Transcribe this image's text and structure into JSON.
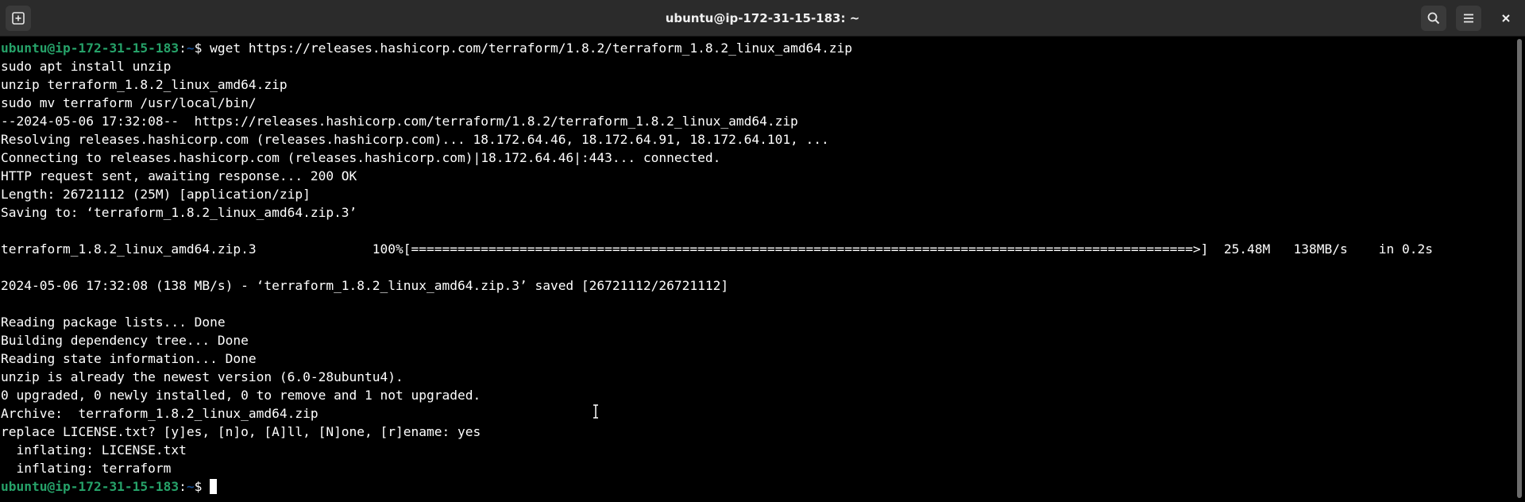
{
  "window": {
    "title": "ubuntu@ip-172-31-15-183: ~"
  },
  "icons": {
    "new_tab": "new-tab-icon",
    "search": "search-icon",
    "menu": "hamburger-menu-icon",
    "close": "close-icon"
  },
  "colors": {
    "prompt_user": "#26a269",
    "prompt_path": "#12488b",
    "background": "#000000",
    "foreground": "#ffffff",
    "headerbar": "#2b2b2b"
  },
  "terminal": {
    "prompt_user": "ubuntu@ip-172-31-15-183",
    "prompt_path": "~",
    "first_command": "wget https://releases.hashicorp.com/terraform/1.8.2/terraform_1.8.2_linux_amd64.zip",
    "lines": [
      "sudo apt install unzip",
      "unzip terraform_1.8.2_linux_amd64.zip",
      "sudo mv terraform /usr/local/bin/",
      "--2024-05-06 17:32:08--  https://releases.hashicorp.com/terraform/1.8.2/terraform_1.8.2_linux_amd64.zip",
      "Resolving releases.hashicorp.com (releases.hashicorp.com)... 18.172.64.46, 18.172.64.91, 18.172.64.101, ...",
      "Connecting to releases.hashicorp.com (releases.hashicorp.com)|18.172.64.46|:443... connected.",
      "HTTP request sent, awaiting response... 200 OK",
      "Length: 26721112 (25M) [application/zip]",
      "Saving to: ‘terraform_1.8.2_linux_amd64.zip.3’",
      "",
      "terraform_1.8.2_linux_amd64.zip.3               100%[=====================================================================================================>]  25.48M   138MB/s    in 0.2s",
      "",
      "2024-05-06 17:32:08 (138 MB/s) - ‘terraform_1.8.2_linux_amd64.zip.3’ saved [26721112/26721112]",
      "",
      "Reading package lists... Done",
      "Building dependency tree... Done",
      "Reading state information... Done",
      "unzip is already the newest version (6.0-28ubuntu4).",
      "0 upgraded, 0 newly installed, 0 to remove and 1 not upgraded.",
      "Archive:  terraform_1.8.2_linux_amd64.zip",
      "replace LICENSE.txt? [y]es, [n]o, [A]ll, [N]one, [r]ename: yes",
      "  inflating: LICENSE.txt",
      "  inflating: terraform"
    ],
    "final_prompt_sym": "$ "
  }
}
